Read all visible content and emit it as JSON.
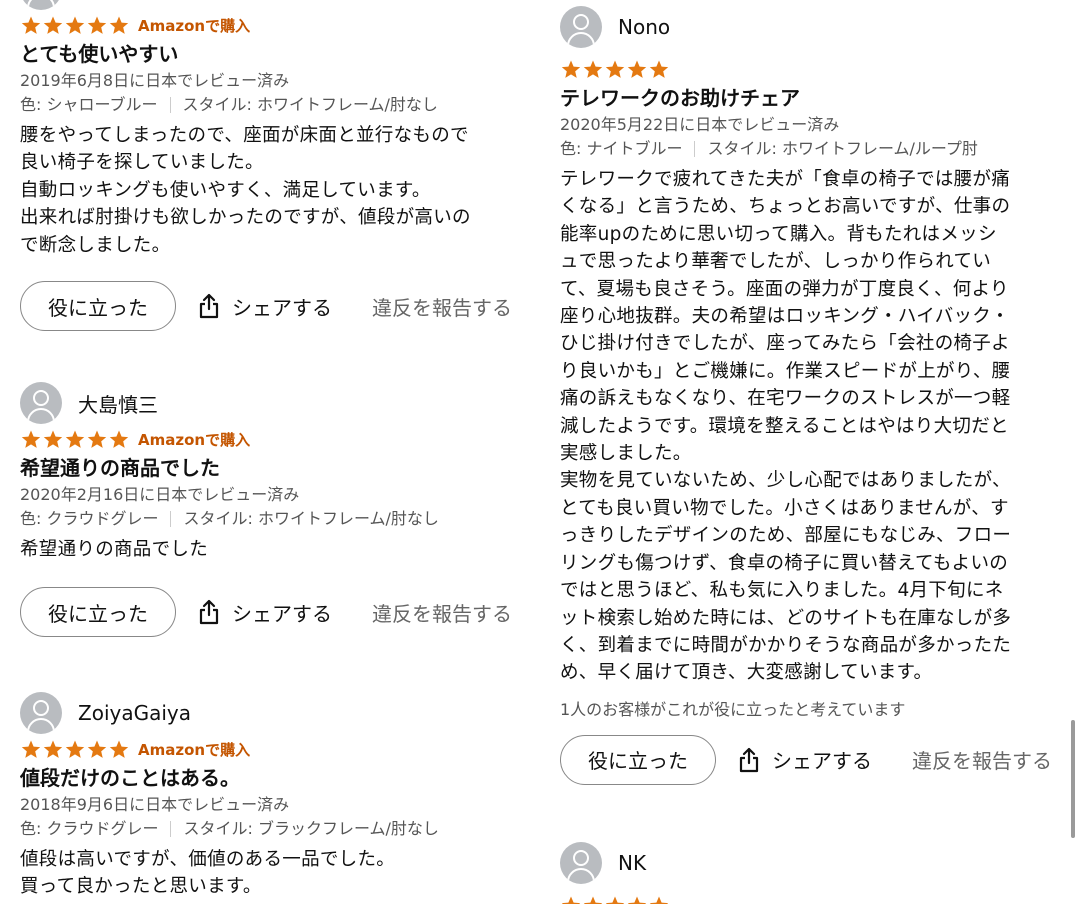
{
  "colors": {
    "star": "#e47911",
    "badge": "#c45500"
  },
  "actions": {
    "helpful_label": "役に立った",
    "share_label": "シェアする",
    "report_label": "違反を報告する"
  },
  "left_reviews": [
    {
      "name": "",
      "badge": "Amazonで購入",
      "rating": 5,
      "title": "とても使いやすい",
      "date": "2019年6月8日に日本でレビュー済み",
      "color": "色: シャローブルー",
      "style": "スタイル: ホワイトフレーム/肘なし",
      "body": [
        "腰をやってしまったので、座面が床面と並行なもので",
        "良い椅子を探していました。",
        "自動ロッキングも使いやすく、満足しています。",
        "出来れば肘掛けも欲しかったのですが、値段が高いの",
        "で断念しました。"
      ]
    },
    {
      "name": "大島慎三",
      "badge": "Amazonで購入",
      "rating": 5,
      "title": "希望通りの商品でした",
      "date": "2020年2月16日に日本でレビュー済み",
      "color": "色: クラウドグレー",
      "style": "スタイル: ホワイトフレーム/肘なし",
      "body": [
        "希望通りの商品でした"
      ]
    },
    {
      "name": "ZoiyaGaiya",
      "badge": "Amazonで購入",
      "rating": 5,
      "title": "値段だけのことはある。",
      "date": "2018年9月6日に日本でレビュー済み",
      "color": "色: クラウドグレー",
      "style": "スタイル: ブラックフレーム/肘なし",
      "body": [
        "値段は高いですが、価値のある一品でした。",
        "買って良かったと思います。"
      ]
    }
  ],
  "right_reviews": [
    {
      "name": "Nono",
      "rating": 5,
      "title": "テレワークのお助けチェア",
      "date": "2020年5月22日に日本でレビュー済み",
      "color": "色: ナイトブルー",
      "style": "スタイル: ホワイトフレーム/ループ肘",
      "body": [
        "テレワークで疲れてきた夫が「食卓の椅子では腰が痛",
        "くなる」と言うため、ちょっとお高いですが、仕事の",
        "能率upのために思い切って購入。背もたれはメッシ",
        "ュで思ったより華奢でしたが、しっかり作られてい",
        "て、夏場も良さそう。座面の弾力が丁度良く、何より",
        "座り心地抜群。夫の希望はロッキング・ハイバック・",
        "ひじ掛け付きでしたが、座ってみたら「会社の椅子よ",
        "り良いかも」とご機嫌に。作業スピードが上がり、腰",
        "痛の訴えもなくなり、在宅ワークのストレスが一つ軽",
        "減したようです。環境を整えることはやはり大切だと",
        "実感しました。",
        "実物を見ていないため、少し心配ではありましたが、",
        "とても良い買い物でした。小さくはありませんが、す",
        "っきりしたデザインのため、部屋にもなじみ、フロー",
        "リングも傷つけず、食卓の椅子に買い替えてもよいの",
        "ではと思うほど、私も気に入りました。4月下旬にネ",
        "ット検索し始めた時には、どのサイトも在庫なしが多",
        "く、到着までに時間がかかりそうな商品が多かったた",
        "め、早く届けて頂き、大変感謝しています。"
      ],
      "helpful_count": "1人のお客様がこれが役に立ったと考えています"
    },
    {
      "name": "NK",
      "rating": 5
    }
  ]
}
